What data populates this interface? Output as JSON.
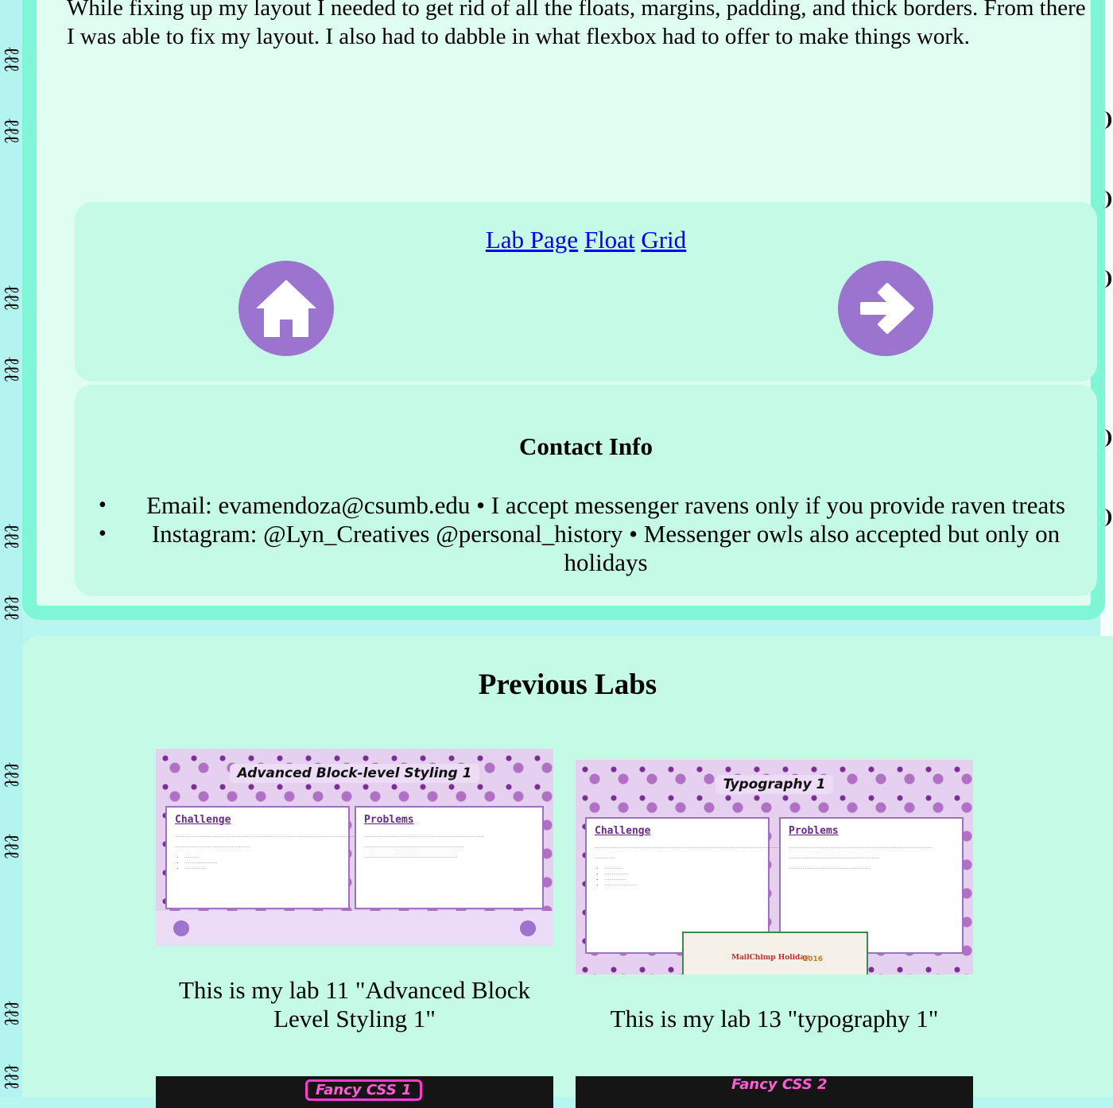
{
  "article": {
    "text": "While fixing up my layout I needed to get rid of all the floats, margins, padding, and thick borders. From there I was able to fix my layout. I also had to dabble in what flexbox had to offer to make things work."
  },
  "nav": {
    "links": [
      "Lab Page",
      "Float",
      "Grid"
    ],
    "home_icon": "home-icon",
    "next_icon": "arrow-right-icon",
    "accent": "#9a74cf"
  },
  "contact": {
    "title": "Contact Info",
    "items": [
      "Email: evamendoza@csumb.edu • I accept messenger ravens only if you provide raven treats",
      "Instagram: @Lyn_Creatives @personal_history • Messenger owls also accepted but only on holidays"
    ]
  },
  "labs": {
    "title": "Previous Labs",
    "cards": [
      {
        "thumb_title": "Advanced Block-level Styling 1",
        "col1": "Challenge",
        "col2": "Problems",
        "caption": "This is my lab 11 \"Advanced Block Level Styling 1\""
      },
      {
        "thumb_title": "Typography 1",
        "col1": "Challenge",
        "col2": "Problems",
        "thumb_inset_1": "MailChimp Holiday",
        "thumb_inset_2": "2016",
        "caption": "This is my lab 13 \"typography 1\""
      }
    ],
    "partial_cards": [
      "Fancy CSS 1",
      "Fancy CSS 2"
    ]
  },
  "colors": {
    "page_bg": "#b8f6f0",
    "panel_border": "#7ff7d6",
    "card_bg": "#c5fbe6",
    "link": "#0000ee"
  }
}
